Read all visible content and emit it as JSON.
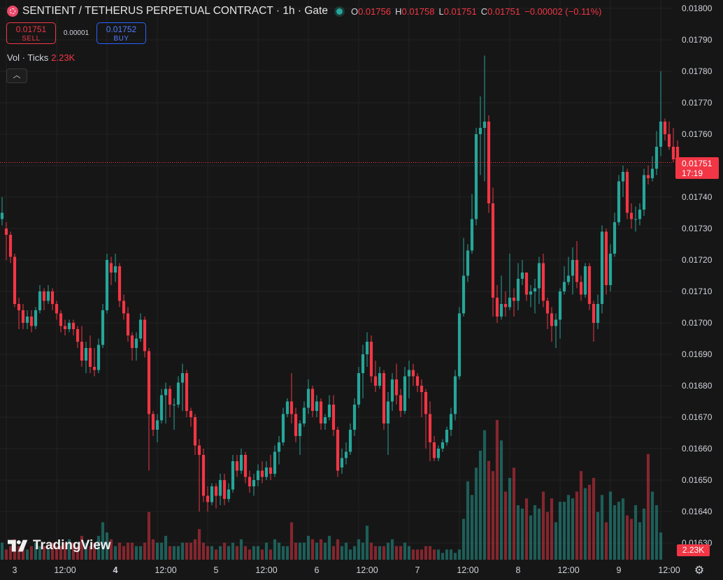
{
  "header": {
    "title": "SENTIENT / TETHERUS PERPETUAL CONTRACT · 1h · Gate",
    "ohlc": {
      "o_label": "O",
      "o": "0.01756",
      "h_label": "H",
      "h": "0.01758",
      "l_label": "L",
      "l": "0.01751",
      "c_label": "C",
      "c": "0.01751",
      "change": "−0.00002 (−0.11%)"
    }
  },
  "trade": {
    "sell_price": "0.01751",
    "sell_label": "SELL",
    "spread": "0.00001",
    "buy_price": "0.01752",
    "buy_label": "BUY"
  },
  "volume": {
    "label": "Vol · Ticks",
    "value": "2.23K"
  },
  "last_price": {
    "value": "0.01751",
    "countdown": "17:19"
  },
  "volume_tag": "2.23K",
  "watermark": "TradingView",
  "colors": {
    "up": "#26a69a",
    "down": "#f23645",
    "background": "#161616",
    "grid": "#232323"
  },
  "chart_data": {
    "type": "candlestick",
    "interval": "1h",
    "y_ticks": [
      "0.01800",
      "0.01790",
      "0.01780",
      "0.01770",
      "0.01760",
      "0.01750",
      "0.01740",
      "0.01730",
      "0.01720",
      "0.01710",
      "0.01700",
      "0.01690",
      "0.01680",
      "0.01670",
      "0.01660",
      "0.01650",
      "0.01640",
      "0.01630"
    ],
    "ylim": [
      0.01627,
      0.01802
    ],
    "x_ticks": [
      {
        "label": "3",
        "bold": false,
        "index": 1
      },
      {
        "label": "12:00",
        "bold": false,
        "index": 13
      },
      {
        "label": "4",
        "bold": true,
        "index": 25
      },
      {
        "label": "12:00",
        "bold": false,
        "index": 37
      },
      {
        "label": "5",
        "bold": false,
        "index": 49
      },
      {
        "label": "12:00",
        "bold": false,
        "index": 61
      },
      {
        "label": "6",
        "bold": false,
        "index": 73
      },
      {
        "label": "12:00",
        "bold": false,
        "index": 85
      },
      {
        "label": "7",
        "bold": false,
        "index": 97
      },
      {
        "label": "12:00",
        "bold": false,
        "index": 109
      },
      {
        "label": "8",
        "bold": false,
        "index": 121
      },
      {
        "label": "12:00",
        "bold": false,
        "index": 133
      },
      {
        "label": "9",
        "bold": false,
        "index": 145
      },
      {
        "label": "12:00",
        "bold": false,
        "index": 157
      }
    ],
    "ohlc": [
      [
        0.01733,
        0.0174,
        0.01731,
        0.01735
      ],
      [
        0.0173,
        0.01732,
        0.0172,
        0.01728
      ],
      [
        0.01728,
        0.01729,
        0.01719,
        0.01721
      ],
      [
        0.01721,
        0.01722,
        0.01705,
        0.01706
      ],
      [
        0.01706,
        0.01708,
        0.01698,
        0.01704
      ],
      [
        0.01704,
        0.01706,
        0.01698,
        0.017
      ],
      [
        0.017,
        0.01704,
        0.01698,
        0.01702
      ],
      [
        0.01702,
        0.01704,
        0.01697,
        0.01699
      ],
      [
        0.01699,
        0.01705,
        0.01698,
        0.01704
      ],
      [
        0.01704,
        0.01712,
        0.01703,
        0.0171
      ],
      [
        0.0171,
        0.01711,
        0.01704,
        0.01707
      ],
      [
        0.01707,
        0.01712,
        0.01706,
        0.0171
      ],
      [
        0.0171,
        0.01711,
        0.01704,
        0.01706
      ],
      [
        0.01706,
        0.01707,
        0.01701,
        0.01703
      ],
      [
        0.01703,
        0.01704,
        0.01697,
        0.01699
      ],
      [
        0.01699,
        0.01701,
        0.01696,
        0.01698
      ],
      [
        0.01698,
        0.01701,
        0.01697,
        0.017
      ],
      [
        0.017,
        0.01701,
        0.01696,
        0.01698
      ],
      [
        0.01698,
        0.01699,
        0.01692,
        0.01694
      ],
      [
        0.01694,
        0.01699,
        0.01686,
        0.01688
      ],
      [
        0.01688,
        0.01694,
        0.01684,
        0.01692
      ],
      [
        0.01692,
        0.01696,
        0.01684,
        0.01686
      ],
      [
        0.01686,
        0.01692,
        0.01683,
        0.01685
      ],
      [
        0.01685,
        0.01695,
        0.01684,
        0.01693
      ],
      [
        0.01693,
        0.01706,
        0.01692,
        0.01704
      ],
      [
        0.01704,
        0.01722,
        0.01703,
        0.0172
      ],
      [
        0.01719,
        0.01721,
        0.01712,
        0.01716
      ],
      [
        0.01716,
        0.01722,
        0.01713,
        0.01718
      ],
      [
        0.01718,
        0.01719,
        0.01705,
        0.01707
      ],
      [
        0.01707,
        0.01709,
        0.01701,
        0.01703
      ],
      [
        0.01703,
        0.01705,
        0.01694,
        0.01696
      ],
      [
        0.01696,
        0.01697,
        0.01688,
        0.01692
      ],
      [
        0.01692,
        0.01697,
        0.01688,
        0.01695
      ],
      [
        0.01695,
        0.01703,
        0.01694,
        0.01701
      ],
      [
        0.01701,
        0.01702,
        0.01689,
        0.01691
      ],
      [
        0.01691,
        0.01692,
        0.01653,
        0.01671
      ],
      [
        0.01671,
        0.01672,
        0.01664,
        0.01666
      ],
      [
        0.01666,
        0.01671,
        0.01662,
        0.01669
      ],
      [
        0.01669,
        0.01679,
        0.01668,
        0.01677
      ],
      [
        0.01677,
        0.01681,
        0.01668,
        0.01679
      ],
      [
        0.01679,
        0.0168,
        0.0167,
        0.01674
      ],
      [
        0.01674,
        0.01676,
        0.01666,
        0.01674
      ],
      [
        0.01674,
        0.01683,
        0.01673,
        0.01681
      ],
      [
        0.01681,
        0.01687,
        0.01672,
        0.01684
      ],
      [
        0.01684,
        0.01685,
        0.0167,
        0.01672
      ],
      [
        0.01672,
        0.01673,
        0.01667,
        0.0167
      ],
      [
        0.0167,
        0.01671,
        0.01658,
        0.01661
      ],
      [
        0.01661,
        0.01663,
        0.0164,
        0.01658
      ],
      [
        0.01658,
        0.0166,
        0.01643,
        0.01645
      ],
      [
        0.01645,
        0.01648,
        0.0164,
        0.01643
      ],
      [
        0.01643,
        0.01649,
        0.01642,
        0.01648
      ],
      [
        0.01648,
        0.01649,
        0.01641,
        0.01645
      ],
      [
        0.01645,
        0.01652,
        0.01642,
        0.0165
      ],
      [
        0.0165,
        0.01652,
        0.01642,
        0.01644
      ],
      [
        0.01644,
        0.01649,
        0.01643,
        0.01647
      ],
      [
        0.01647,
        0.01658,
        0.01646,
        0.01656
      ],
      [
        0.01656,
        0.01658,
        0.01651,
        0.01653
      ],
      [
        0.01653,
        0.0166,
        0.01652,
        0.01658
      ],
      [
        0.01658,
        0.01659,
        0.01649,
        0.01651
      ],
      [
        0.01651,
        0.01653,
        0.01646,
        0.01648
      ],
      [
        0.01648,
        0.01652,
        0.01645,
        0.0165
      ],
      [
        0.0165,
        0.01655,
        0.01648,
        0.01653
      ],
      [
        0.01653,
        0.01656,
        0.01649,
        0.01651
      ],
      [
        0.01651,
        0.01656,
        0.0165,
        0.01654
      ],
      [
        0.01654,
        0.01658,
        0.0165,
        0.01652
      ],
      [
        0.01652,
        0.01661,
        0.01651,
        0.01659
      ],
      [
        0.01659,
        0.01664,
        0.01655,
        0.01662
      ],
      [
        0.01662,
        0.01673,
        0.01661,
        0.01671
      ],
      [
        0.01671,
        0.01676,
        0.0167,
        0.01675
      ],
      [
        0.01675,
        0.01684,
        0.01668,
        0.01671
      ],
      [
        0.01671,
        0.01673,
        0.01662,
        0.01664
      ],
      [
        0.01664,
        0.01669,
        0.01658,
        0.01668
      ],
      [
        0.01668,
        0.01675,
        0.01667,
        0.01673
      ],
      [
        0.01673,
        0.01682,
        0.01671,
        0.01679
      ],
      [
        0.01679,
        0.0168,
        0.0167,
        0.01672
      ],
      [
        0.01672,
        0.01677,
        0.0167,
        0.01675
      ],
      [
        0.01675,
        0.01676,
        0.01666,
        0.01668
      ],
      [
        0.01668,
        0.01671,
        0.01666,
        0.0167
      ],
      [
        0.0167,
        0.01677,
        0.01669,
        0.01674
      ],
      [
        0.01674,
        0.01677,
        0.01664,
        0.01666
      ],
      [
        0.01666,
        0.01667,
        0.01651,
        0.01653
      ],
      [
        0.01654,
        0.0166,
        0.01652,
        0.01657
      ],
      [
        0.01657,
        0.01662,
        0.01655,
        0.01659
      ],
      [
        0.01659,
        0.01668,
        0.01658,
        0.01666
      ],
      [
        0.01666,
        0.01676,
        0.01664,
        0.01674
      ],
      [
        0.01674,
        0.01686,
        0.01673,
        0.01684
      ],
      [
        0.01684,
        0.01693,
        0.01676,
        0.0169
      ],
      [
        0.0169,
        0.01697,
        0.01686,
        0.01694
      ],
      [
        0.01694,
        0.01696,
        0.01681,
        0.01683
      ],
      [
        0.01683,
        0.01688,
        0.01678,
        0.0168
      ],
      [
        0.0168,
        0.01686,
        0.01679,
        0.01684
      ],
      [
        0.01684,
        0.01685,
        0.01666,
        0.01668
      ],
      [
        0.01668,
        0.01678,
        0.01658,
        0.01675
      ],
      [
        0.01675,
        0.01684,
        0.01672,
        0.01682
      ],
      [
        0.01682,
        0.01687,
        0.01674,
        0.01677
      ],
      [
        0.01677,
        0.01679,
        0.0167,
        0.01672
      ],
      [
        0.01672,
        0.01686,
        0.01671,
        0.01683
      ],
      [
        0.01683,
        0.01688,
        0.01676,
        0.01685
      ],
      [
        0.01685,
        0.01687,
        0.0168,
        0.01683
      ],
      [
        0.01683,
        0.01684,
        0.01678,
        0.0168
      ],
      [
        0.0168,
        0.01682,
        0.0167,
        0.01678
      ],
      [
        0.01678,
        0.01679,
        0.0166,
        0.01671
      ],
      [
        0.01671,
        0.01675,
        0.01656,
        0.01662
      ],
      [
        0.01662,
        0.01664,
        0.01656,
        0.01657
      ],
      [
        0.01657,
        0.01661,
        0.01656,
        0.0166
      ],
      [
        0.0166,
        0.01663,
        0.01659,
        0.01662
      ],
      [
        0.01662,
        0.01667,
        0.01661,
        0.01666
      ],
      [
        0.01666,
        0.01673,
        0.01664,
        0.01671
      ],
      [
        0.01671,
        0.01685,
        0.01669,
        0.01683
      ],
      [
        0.01683,
        0.01705,
        0.01682,
        0.01703
      ],
      [
        0.01703,
        0.01727,
        0.01702,
        0.01715
      ],
      [
        0.01715,
        0.01725,
        0.01713,
        0.01723
      ],
      [
        0.01723,
        0.01741,
        0.01722,
        0.01733
      ],
      [
        0.01733,
        0.01762,
        0.01731,
        0.0176
      ],
      [
        0.0176,
        0.01772,
        0.01747,
        0.01762
      ],
      [
        0.01762,
        0.01785,
        0.01745,
        0.01764
      ],
      [
        0.01764,
        0.01766,
        0.01735,
        0.01738
      ],
      [
        0.01738,
        0.01743,
        0.01702,
        0.01708
      ],
      [
        0.01708,
        0.01712,
        0.017,
        0.01702
      ],
      [
        0.01702,
        0.01715,
        0.01701,
        0.01706
      ],
      [
        0.01706,
        0.0171,
        0.01702,
        0.01705
      ],
      [
        0.01705,
        0.01722,
        0.01704,
        0.01708
      ],
      [
        0.01708,
        0.01711,
        0.01702,
        0.01707
      ],
      [
        0.01707,
        0.01719,
        0.01704,
        0.01714
      ],
      [
        0.01714,
        0.0172,
        0.01712,
        0.01716
      ],
      [
        0.01716,
        0.01716,
        0.01707,
        0.01709
      ],
      [
        0.01709,
        0.01712,
        0.01705,
        0.0171
      ],
      [
        0.0171,
        0.01714,
        0.01703,
        0.01711
      ],
      [
        0.01711,
        0.01721,
        0.01706,
        0.01719
      ],
      [
        0.01719,
        0.01722,
        0.01705,
        0.01707
      ],
      [
        0.01707,
        0.01708,
        0.01698,
        0.01703
      ],
      [
        0.01703,
        0.01705,
        0.01694,
        0.01699
      ],
      [
        0.01699,
        0.01703,
        0.01692,
        0.01701
      ],
      [
        0.01701,
        0.01711,
        0.01695,
        0.0171
      ],
      [
        0.0171,
        0.01718,
        0.01709,
        0.01713
      ],
      [
        0.01713,
        0.01721,
        0.01712,
        0.01715
      ],
      [
        0.01715,
        0.01724,
        0.01709,
        0.0172
      ],
      [
        0.0172,
        0.01726,
        0.01711,
        0.01713
      ],
      [
        0.01713,
        0.01715,
        0.01707,
        0.01709
      ],
      [
        0.01709,
        0.01719,
        0.01708,
        0.01718
      ],
      [
        0.01718,
        0.01719,
        0.01704,
        0.01706
      ],
      [
        0.01706,
        0.01707,
        0.01694,
        0.017
      ],
      [
        0.017,
        0.01709,
        0.01698,
        0.01706
      ],
      [
        0.01706,
        0.01731,
        0.01703,
        0.01729
      ],
      [
        0.01729,
        0.0173,
        0.01709,
        0.01712
      ],
      [
        0.01712,
        0.01725,
        0.0171,
        0.01722
      ],
      [
        0.01722,
        0.01735,
        0.01721,
        0.01732
      ],
      [
        0.01732,
        0.01747,
        0.01731,
        0.01745
      ],
      [
        0.01745,
        0.0175,
        0.0174,
        0.01748
      ],
      [
        0.01748,
        0.01749,
        0.01733,
        0.01735
      ],
      [
        0.01735,
        0.01738,
        0.0173,
        0.01733
      ],
      [
        0.01733,
        0.01737,
        0.01729,
        0.01733
      ],
      [
        0.01733,
        0.01738,
        0.01731,
        0.01736
      ],
      [
        0.01736,
        0.01749,
        0.01734,
        0.01747
      ],
      [
        0.01747,
        0.0175,
        0.01744,
        0.01746
      ],
      [
        0.01746,
        0.01753,
        0.01745,
        0.01749
      ],
      [
        0.01749,
        0.01761,
        0.01747,
        0.01756
      ],
      [
        0.01756,
        0.0178,
        0.01753,
        0.01764
      ],
      [
        0.01764,
        0.01765,
        0.01758,
        0.0176
      ],
      [
        0.0176,
        0.01764,
        0.01755,
        0.01756
      ],
      [
        0.01756,
        0.01762,
        0.01751,
        0.01752
      ],
      [
        0.01756,
        0.01758,
        0.01751,
        0.01751
      ]
    ],
    "volume": [
      5,
      3,
      4,
      6,
      4,
      4,
      3,
      4,
      5,
      4,
      4,
      3,
      5,
      4,
      4,
      5,
      6,
      5,
      4,
      7,
      5,
      4,
      5,
      7,
      11,
      8,
      6,
      4,
      5,
      4,
      5,
      5,
      4,
      4,
      5,
      14,
      6,
      5,
      5,
      7,
      4,
      4,
      4,
      5,
      5,
      5,
      6,
      9,
      5,
      4,
      4,
      3,
      4,
      5,
      4,
      5,
      4,
      6,
      4,
      3,
      4,
      4,
      3,
      5,
      3,
      6,
      5,
      4,
      4,
      11,
      5,
      5,
      5,
      7,
      6,
      5,
      6,
      5,
      7,
      4,
      6,
      4,
      5,
      3,
      4,
      6,
      5,
      10,
      5,
      4,
      4,
      4,
      5,
      6,
      4,
      4,
      5,
      4,
      3,
      3,
      3,
      4,
      4,
      3,
      3,
      2,
      3,
      3,
      2,
      3,
      12,
      23,
      19,
      27,
      32,
      38,
      29,
      26,
      41,
      35,
      20,
      24,
      27,
      16,
      15,
      18,
      13,
      16,
      15,
      20,
      14,
      18,
      11,
      17,
      17,
      19,
      18,
      20,
      26,
      21,
      22,
      24,
      14,
      19,
      11,
      20,
      16,
      17,
      18,
      13,
      12,
      16,
      11,
      15,
      31,
      20,
      16,
      8
    ]
  }
}
